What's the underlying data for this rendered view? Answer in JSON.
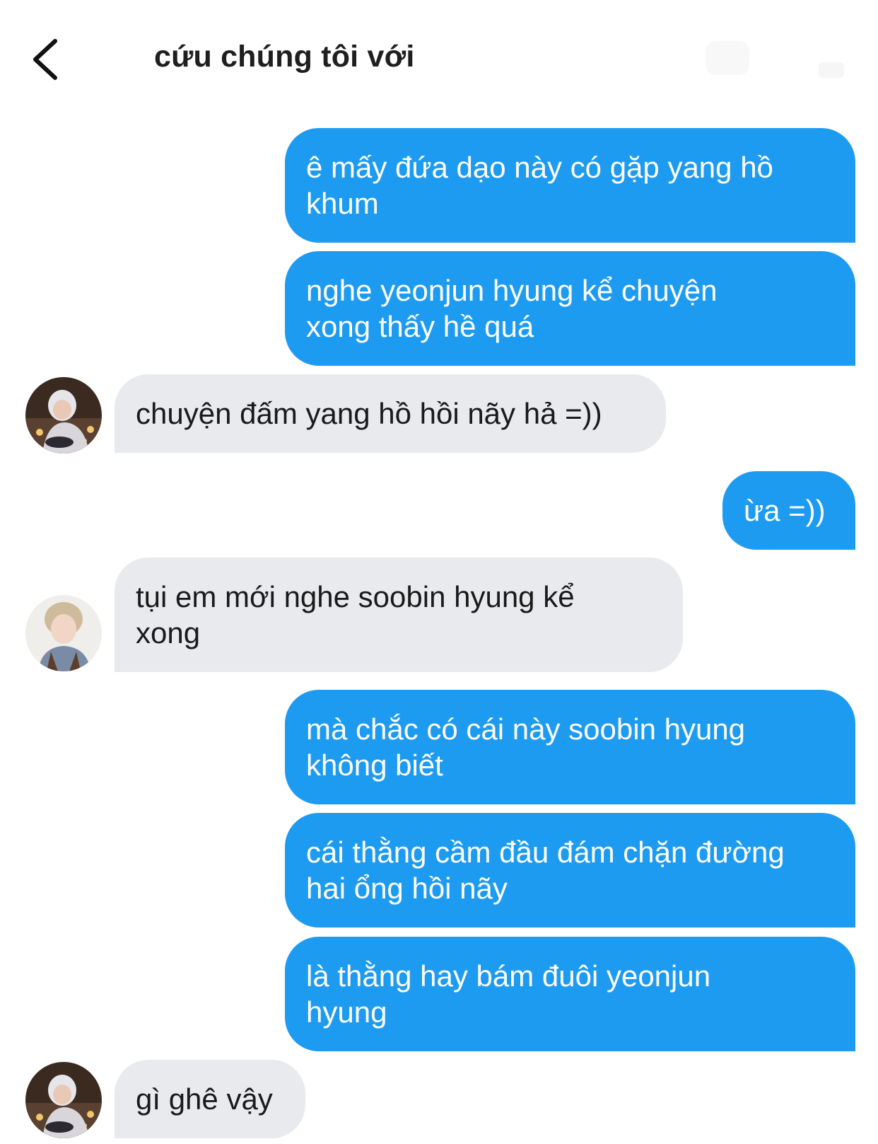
{
  "header": {
    "title": "cứu chúng tôi với",
    "back_icon": "chevron-left-icon"
  },
  "colors": {
    "sent_bubble": "#1d9bf0",
    "received_bubble": "#e9eaee",
    "sent_text": "#ffffff",
    "received_text": "#1a1a1a"
  },
  "messages": [
    {
      "direction": "sent",
      "text": "ê mấy đứa dạo này có gặp yang hồ\nkhum"
    },
    {
      "direction": "sent",
      "text": "nghe yeonjun hyung kể chuyện\nxong thấy hề quá"
    },
    {
      "direction": "received",
      "avatar": "avatar-silver-hair",
      "text": "chuyện đấm yang hồ hồi nãy hả =))"
    },
    {
      "direction": "sent",
      "text": "ừa =))"
    },
    {
      "direction": "received",
      "avatar": "avatar-light-hair",
      "text": "tụi em mới nghe soobin hyung kể\nxong"
    },
    {
      "direction": "sent",
      "text": "mà chắc có cái này soobin hyung\nkhông biết"
    },
    {
      "direction": "sent",
      "text": "cái thằng cầm đầu đám chặn đường\nhai ổng hồi nãy"
    },
    {
      "direction": "sent",
      "text": "là thằng hay bám đuôi yeonjun\nhyung"
    },
    {
      "direction": "received",
      "avatar": "avatar-silver-hair",
      "text": "gì ghê vậy"
    }
  ]
}
